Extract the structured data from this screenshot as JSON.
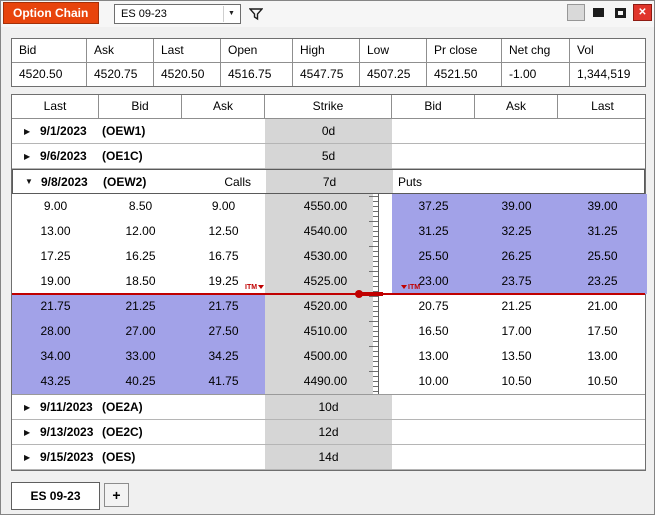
{
  "window": {
    "title": "Option Chain",
    "symbol": "ES 09-23"
  },
  "icons": {
    "dropdown_arrow": "▼",
    "collapsed_arrow": "▶",
    "expanded_arrow": "▼",
    "close": "✕"
  },
  "colors": {
    "title_bg": "#e8440c",
    "itm_highlight": "#a2a2e8",
    "price_line": "#c00000",
    "strike_bg": "#d6d6d6",
    "close_bg": "#e0352b"
  },
  "quote": {
    "headers": [
      "Bid",
      "Ask",
      "Last",
      "Open",
      "High",
      "Low",
      "Pr close",
      "Net chg",
      "Vol"
    ],
    "values": [
      "4520.50",
      "4520.75",
      "4520.50",
      "4516.75",
      "4547.75",
      "4507.25",
      "4521.50",
      "-1.00",
      "1,344,519"
    ]
  },
  "chain": {
    "headers": [
      "Last",
      "Bid",
      "Ask",
      "Strike",
      "Bid",
      "Ask",
      "Last"
    ],
    "itm_label": "ITM",
    "groups": [
      {
        "date": "9/1/2023",
        "code": "(OEW1)",
        "days": "0d",
        "expanded": false
      },
      {
        "date": "9/6/2023",
        "code": "(OE1C)",
        "days": "5d",
        "expanded": false
      },
      {
        "date": "9/8/2023",
        "code": "(OEW2)",
        "days": "7d",
        "expanded": true,
        "calls_label": "Calls",
        "puts_label": "Puts",
        "rows": [
          {
            "call_last": "9.00",
            "call_bid": "8.50",
            "call_ask": "9.00",
            "strike": "4550.00",
            "put_bid": "37.25",
            "put_ask": "39.00",
            "put_last": "39.00",
            "call_itm": false,
            "put_itm": true
          },
          {
            "call_last": "13.00",
            "call_bid": "12.00",
            "call_ask": "12.50",
            "strike": "4540.00",
            "put_bid": "31.25",
            "put_ask": "32.25",
            "put_last": "31.25",
            "call_itm": false,
            "put_itm": true
          },
          {
            "call_last": "17.25",
            "call_bid": "16.25",
            "call_ask": "16.75",
            "strike": "4530.00",
            "put_bid": "25.50",
            "put_ask": "26.25",
            "put_last": "25.50",
            "call_itm": false,
            "put_itm": true
          },
          {
            "call_last": "19.00",
            "call_bid": "18.50",
            "call_ask": "19.25",
            "strike": "4525.00",
            "put_bid": "23.00",
            "put_ask": "23.75",
            "put_last": "23.25",
            "call_itm": false,
            "put_itm": true
          },
          {
            "call_last": "21.75",
            "call_bid": "21.25",
            "call_ask": "21.75",
            "strike": "4520.00",
            "put_bid": "20.75",
            "put_ask": "21.25",
            "put_last": "21.00",
            "call_itm": true,
            "put_itm": false
          },
          {
            "call_last": "28.00",
            "call_bid": "27.00",
            "call_ask": "27.50",
            "strike": "4510.00",
            "put_bid": "16.50",
            "put_ask": "17.00",
            "put_last": "17.50",
            "call_itm": true,
            "put_itm": false
          },
          {
            "call_last": "34.00",
            "call_bid": "33.00",
            "call_ask": "34.25",
            "strike": "4500.00",
            "put_bid": "13.00",
            "put_ask": "13.50",
            "put_last": "13.00",
            "call_itm": true,
            "put_itm": false
          },
          {
            "call_last": "43.25",
            "call_bid": "40.25",
            "call_ask": "41.75",
            "strike": "4490.00",
            "put_bid": "10.00",
            "put_ask": "10.50",
            "put_last": "10.50",
            "call_itm": true,
            "put_itm": false
          }
        ]
      },
      {
        "date": "9/11/2023",
        "code": "(OE2A)",
        "days": "10d",
        "expanded": false
      },
      {
        "date": "9/13/2023",
        "code": "(OE2C)",
        "days": "12d",
        "expanded": false
      },
      {
        "date": "9/15/2023",
        "code": "(OES)",
        "days": "14d",
        "expanded": false
      }
    ]
  },
  "tabs": {
    "active": "ES 09-23",
    "add_label": "+"
  }
}
